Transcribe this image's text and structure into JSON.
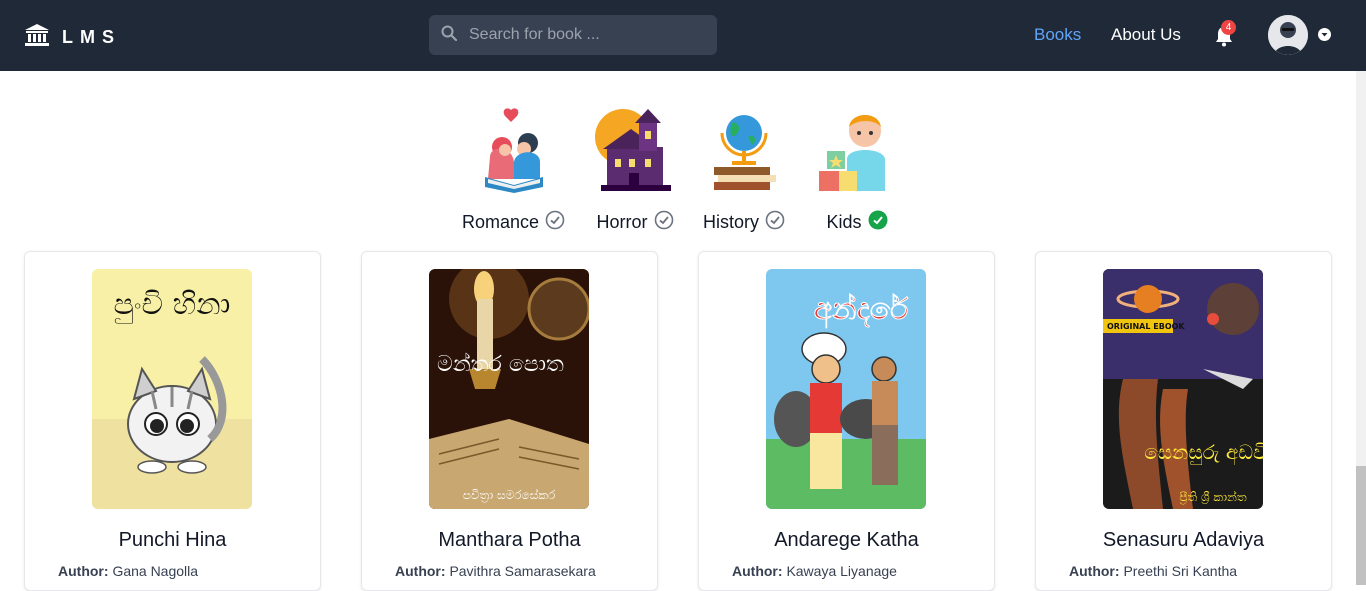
{
  "brand": {
    "name": "LMS",
    "icon": "bank-icon"
  },
  "search": {
    "placeholder": "Search for book ...",
    "value": ""
  },
  "nav": {
    "books": "Books",
    "about": "About Us"
  },
  "notifications": {
    "count": "4"
  },
  "colors": {
    "navbar": "#1f2937",
    "accent": "#60a5fa",
    "badge": "#ef4444",
    "selected": "#16a34a"
  },
  "categories": [
    {
      "label": "Romance",
      "selected": false
    },
    {
      "label": "Horror",
      "selected": false
    },
    {
      "label": "History",
      "selected": false
    },
    {
      "label": "Kids",
      "selected": true
    }
  ],
  "books": [
    {
      "title": "Punchi Hina",
      "author_label": "Author:",
      "author": "Gana Nagolla",
      "cover_text": "පුංචි හිනා"
    },
    {
      "title": "Manthara Potha",
      "author_label": "Author:",
      "author": "Pavithra Samarasekara",
      "cover_text": "මන්තර පොත",
      "cover_subtext": "පවිත්‍රා සමරසේකර"
    },
    {
      "title": "Andarege Katha",
      "author_label": "Author:",
      "author": "Kawaya Liyanage",
      "cover_text": "අන්දරේ"
    },
    {
      "title": "Senasuru Adaviya",
      "author_label": "Author:",
      "author": "Preethi Sri Kantha",
      "cover_text": "සෙනසුරු අඩවිය",
      "cover_badge": "ORIGINAL EBOOK",
      "cover_subtext": "ප්‍රීති ශ්‍රී කාන්ත"
    }
  ]
}
